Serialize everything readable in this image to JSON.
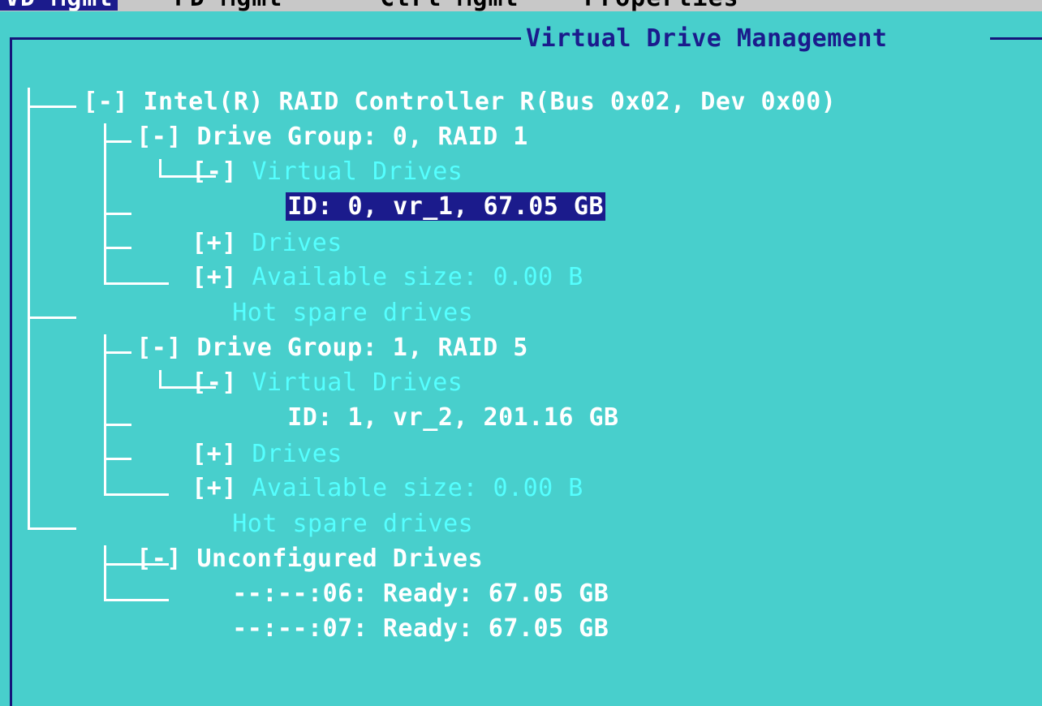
{
  "colors": {
    "background": "#48cfcc",
    "frame": "#15157a",
    "highlight": "#1b1b8c",
    "tree_line": "#ffffff",
    "category_text": "#55ffff"
  },
  "tabs": [
    {
      "label": "VD Mgmt",
      "active": true
    },
    {
      "label": "PD Mgmt",
      "active": false
    },
    {
      "label": "Ctrl Mgmt",
      "active": false
    },
    {
      "label": "Properties",
      "active": false
    }
  ],
  "panel": {
    "title": "Virtual Drive Management"
  },
  "tree": {
    "controller": {
      "toggle": "[-]",
      "label": "Intel(R) RAID Controller R(Bus 0x02, Dev 0x00)"
    },
    "group0": {
      "toggle": "[-]",
      "label": "Drive Group: 0, RAID 1",
      "vd_toggle": "[-]",
      "vd_label": "Virtual Drives",
      "vd_item": "ID: 0, vr_1, 67.05 GB",
      "drives_toggle": "[+]",
      "drives_label": "Drives",
      "avail_toggle": "[+]",
      "avail_label": "Available size: 0.00 B",
      "hotspare_label": "Hot spare drives"
    },
    "group1": {
      "toggle": "[-]",
      "label": "Drive Group: 1, RAID 5",
      "vd_toggle": "[-]",
      "vd_label": "Virtual Drives",
      "vd_item": "ID: 1, vr_2, 201.16 GB",
      "drives_toggle": "[+]",
      "drives_label": "Drives",
      "avail_toggle": "[+]",
      "avail_label": "Available size: 0.00 B",
      "hotspare_label": "Hot spare drives"
    },
    "unconfigured": {
      "toggle": "[-]",
      "label": "Unconfigured Drives",
      "items": [
        "--:--:06: Ready: 67.05 GB",
        "--:--:07: Ready: 67.05 GB"
      ]
    }
  }
}
